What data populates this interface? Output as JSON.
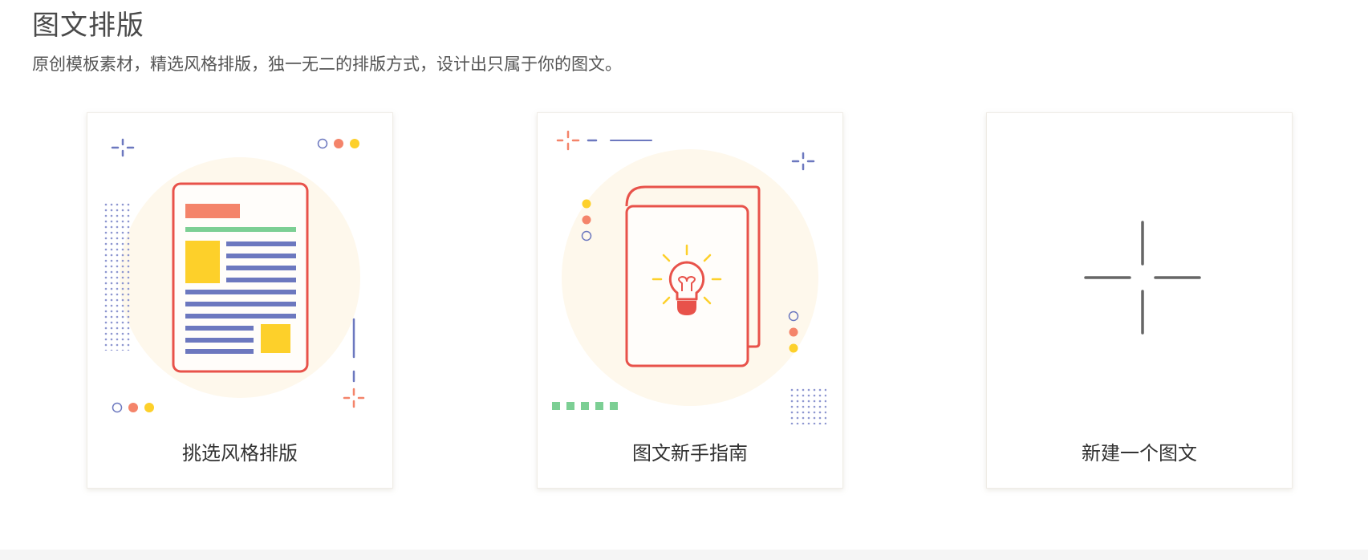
{
  "header": {
    "title": "图文排版",
    "description": "原创模板素材，精选风格排版，独一无二的排版方式，设计出只属于你的图文。"
  },
  "cards": [
    {
      "label": "挑选风格排版",
      "icon": "document-layout-icon"
    },
    {
      "label": "图文新手指南",
      "icon": "lightbulb-guide-icon"
    },
    {
      "label": "新建一个图文",
      "icon": "plus-icon"
    }
  ],
  "colors": {
    "red": "#e8524a",
    "salmon": "#f4846a",
    "yellow": "#fdd02a",
    "blue": "#6c78bf",
    "green": "#7ccf94",
    "circle_bg": "#fef8ec",
    "plus": "#666666"
  }
}
